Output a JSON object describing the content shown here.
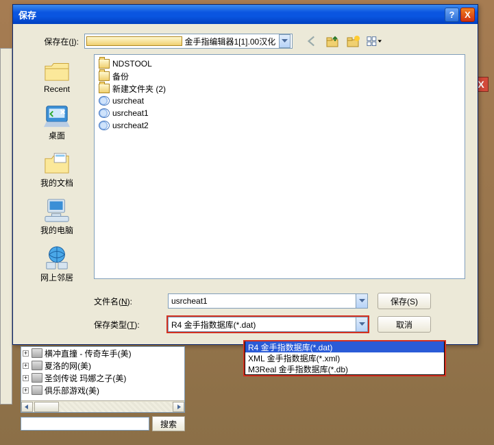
{
  "dialog": {
    "title": "保存",
    "help_glyph": "?",
    "close_glyph": "X",
    "save_in_label_pre": "保存在(",
    "save_in_key": "I",
    "save_in_label_post": "):",
    "save_in_value": "金手指编辑器1[1].00汉化",
    "filename_label_pre": "文件名(",
    "filename_key": "N",
    "filename_label_post": "):",
    "filename_value": "usrcheat1",
    "save_button": "保存(S)",
    "type_label_pre": "保存类型(",
    "type_key": "T",
    "type_label_post": "):",
    "type_selected": "R4 金手指数据库(*.dat)",
    "cancel_button": "取消",
    "type_options": [
      "R4 金手指数据库(*.dat)",
      "XML 金手指数据库(*.xml)",
      "M3Real 金手指数据库(*.db)"
    ]
  },
  "sidebar": {
    "items": [
      {
        "label": "Recent"
      },
      {
        "label": "桌面"
      },
      {
        "label": "我的文档"
      },
      {
        "label": "我的电脑"
      },
      {
        "label": "网上邻居"
      }
    ]
  },
  "file_list": [
    {
      "name": "NDSTOOL",
      "type": "folder"
    },
    {
      "name": "备份",
      "type": "folder"
    },
    {
      "name": "新建文件夹 (2)",
      "type": "folder"
    },
    {
      "name": "usrcheat",
      "type": "file"
    },
    {
      "name": "usrcheat1",
      "type": "file"
    },
    {
      "name": "usrcheat2",
      "type": "file"
    }
  ],
  "bg_tree": [
    "横冲直撞 - 传奇车手(美)",
    "夏洛的网(美)",
    "圣剑传说 玛娜之子(美)",
    "俱乐部游戏(美)"
  ],
  "search": {
    "placeholder": "",
    "button": "搜索"
  },
  "bg_close_glyph": "X"
}
